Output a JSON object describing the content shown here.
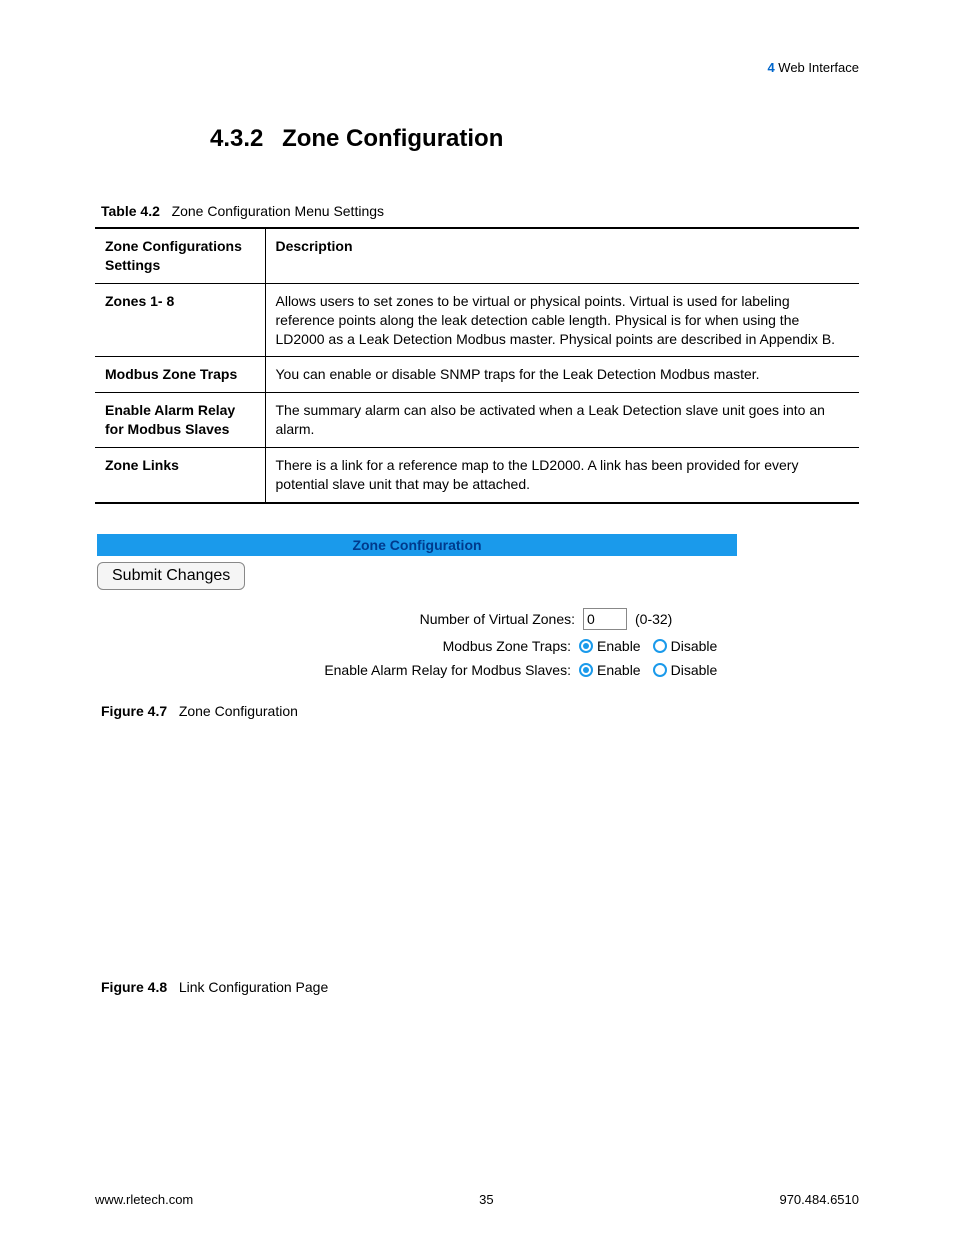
{
  "header": {
    "chapter_num": "4",
    "chapter_title": "Web Interface"
  },
  "section": {
    "number": "4.3.2",
    "title": "Zone Configuration"
  },
  "table": {
    "caption_bold": "Table 4.2",
    "caption_text": "Zone Configuration Menu Settings",
    "col1_header": "Zone Configurations Settings",
    "col2_header": "Description",
    "rows": [
      {
        "setting": "Zones 1- 8",
        "description": "Allows users to set zones to be virtual or physical points. Virtual is used for labeling reference points along the leak detection cable length. Physical is for when using the LD2000 as a Leak Detection Modbus master. Physical points are described in Appendix B."
      },
      {
        "setting": "Modbus Zone Traps",
        "description": "You can enable or disable SNMP traps for the Leak Detection Modbus master."
      },
      {
        "setting": "Enable Alarm Relay for Modbus Slaves",
        "description": "The summary alarm can also be activated when a Leak Detection slave unit goes into an alarm."
      },
      {
        "setting": "Zone Links",
        "description": "There is a link for a reference map to the LD2000. A link has been provided for every potential slave unit that may be attached."
      }
    ]
  },
  "screenshot": {
    "banner": "Zone Configuration",
    "submit_label": "Submit Changes",
    "row1_label": "Number of Virtual Zones:",
    "row1_value": "0",
    "row1_range": "(0-32)",
    "row2_label": "Modbus Zone Traps:",
    "row3_label": "Enable Alarm Relay for Modbus Slaves:",
    "enable_label": "Enable",
    "disable_label": "Disable"
  },
  "figure1": {
    "bold": "Figure 4.7",
    "text": "Zone Configuration"
  },
  "figure2": {
    "bold": "Figure 4.8",
    "text": "Link Configuration Page"
  },
  "footer": {
    "left": "www.rletech.com",
    "center": "35",
    "right": "970.484.6510"
  }
}
